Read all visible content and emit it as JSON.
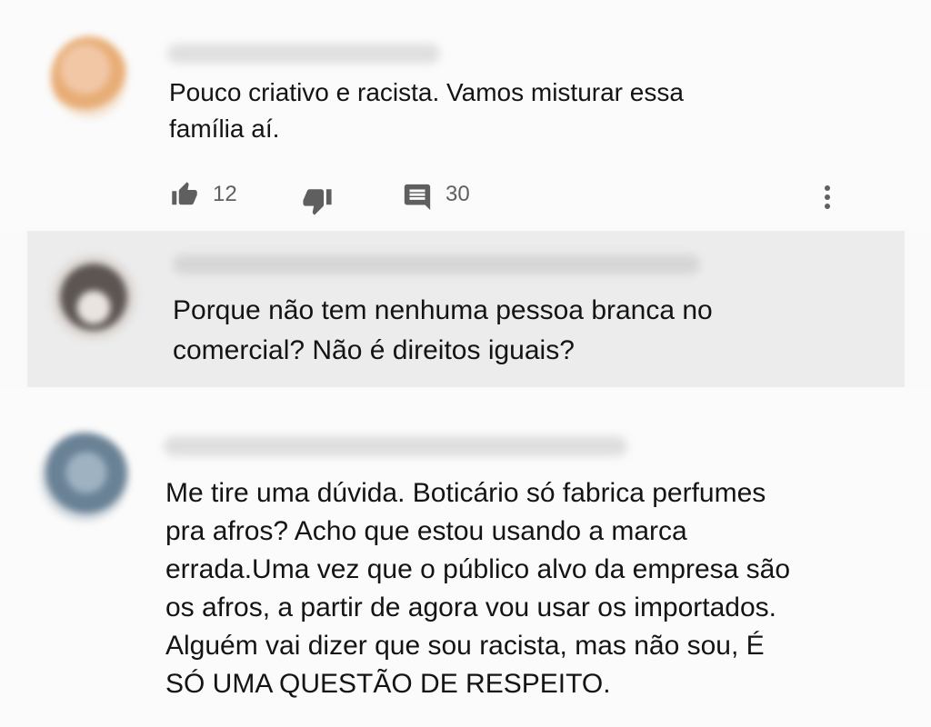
{
  "comments": [
    {
      "text": "Pouco criativo e racista. Vamos misturar essa\nfamília aí.",
      "likes": "12",
      "replies": "30"
    },
    {
      "text": "Porque não tem nenhuma pessoa branca no\ncomercial? Não é direitos iguais?"
    },
    {
      "text": "Me tire uma dúvida. Boticário só fabrica perfumes\npra afros? Acho que estou usando a marca\nerrada.Uma vez que o público alvo da empresa são\nos afros,  a partir de agora vou usar os importados.\nAlguém vai dizer que sou racista,  mas não sou, É\nSÓ UMA QUESTÃO DE RESPEITO."
    }
  ],
  "icons": [
    "thumbs-up-icon",
    "thumbs-down-icon",
    "reply-icon",
    "more-vert-icon"
  ],
  "colors": {
    "icon": "#5f5f5f",
    "highlight_bg": "#ececec",
    "page_bg": "#fafafa"
  }
}
